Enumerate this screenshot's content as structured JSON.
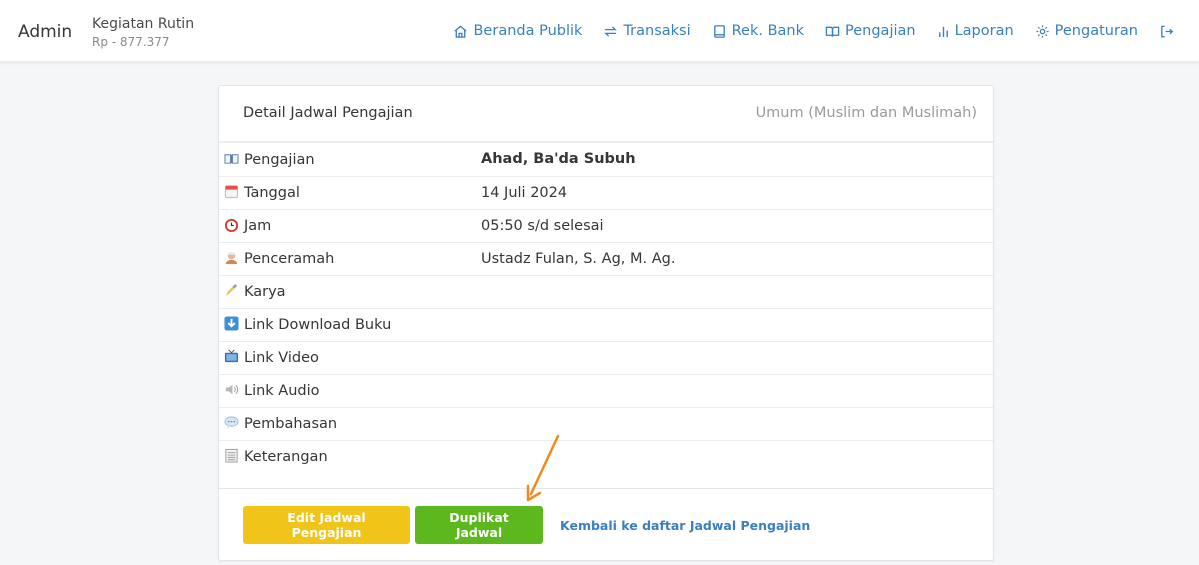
{
  "navbar": {
    "brand": "Admin",
    "org_name": "Kegiatan Rutin",
    "org_balance": "Rp - 877.377",
    "links": [
      {
        "label": "Beranda Publik",
        "icon": "home-icon"
      },
      {
        "label": "Transaksi",
        "icon": "repeat-icon"
      },
      {
        "label": "Rek. Bank",
        "icon": "book-icon"
      },
      {
        "label": "Pengajian",
        "icon": "open-book-icon"
      },
      {
        "label": "Laporan",
        "icon": "bar-chart-icon"
      },
      {
        "label": "Pengaturan",
        "icon": "gear-icon"
      }
    ],
    "logout_icon": "logout-icon"
  },
  "card": {
    "title": "Detail Jadwal Pengajian",
    "category": "Umum (Muslim dan Muslimah)",
    "rows": [
      {
        "label": "Pengajian",
        "value": "Ahad, Ba'da Subuh",
        "icon": "open-book-emoji"
      },
      {
        "label": "Tanggal",
        "value": "14 Juli 2024",
        "icon": "calendar-emoji"
      },
      {
        "label": "Jam",
        "value": "05:50 s/d selesai",
        "icon": "alarm-clock-emoji"
      },
      {
        "label": "Penceramah",
        "value": "Ustadz Fulan, S. Ag, M. Ag.",
        "icon": "person-emoji"
      },
      {
        "label": "Karya",
        "value": "",
        "icon": "writing-hand-emoji"
      },
      {
        "label": "Link Download Buku",
        "value": "",
        "icon": "down-arrow-emoji"
      },
      {
        "label": "Link Video",
        "value": "",
        "icon": "television-emoji"
      },
      {
        "label": "Link Audio",
        "value": "",
        "icon": "speaker-emoji"
      },
      {
        "label": "Pembahasan",
        "value": "",
        "icon": "speech-bubble-emoji"
      },
      {
        "label": "Keterangan",
        "value": "",
        "icon": "notepad-emoji"
      }
    ]
  },
  "actions": {
    "edit_label": "Edit Jadwal Pengajian",
    "duplicate_label": "Duplikat Jadwal",
    "back_label": "Kembali ke daftar Jadwal Pengajian"
  },
  "colors": {
    "link": "#3a7fc1",
    "edit_button": "#f0c419",
    "duplicate_button": "#5cb81c",
    "annotation_arrow": "#f08a1c"
  }
}
